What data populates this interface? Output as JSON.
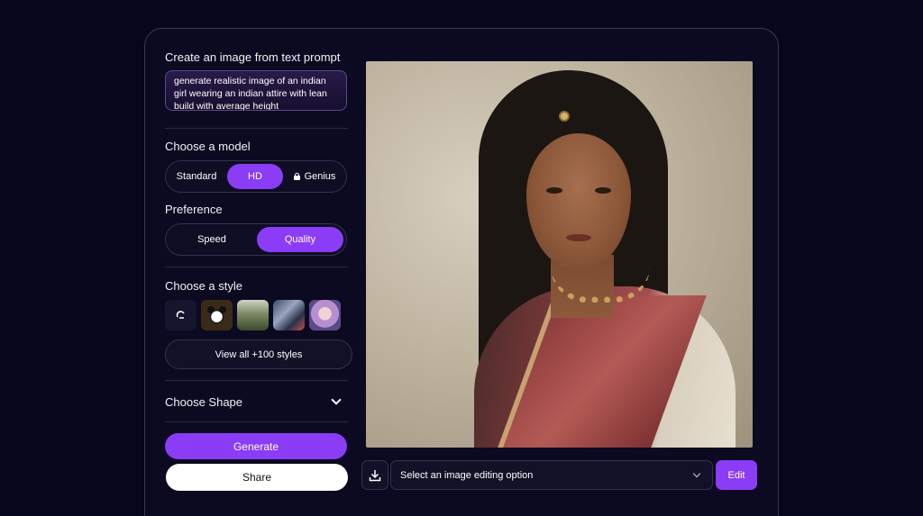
{
  "prompt_section": {
    "title": "Create an image from text prompt",
    "prompt_text": "generate realistic image of an indian girl wearing an indian attire with lean build with average height"
  },
  "model_section": {
    "title": "Choose a model",
    "options": [
      "Standard",
      "HD",
      "Genius"
    ],
    "selected": "HD",
    "locked": [
      "Genius"
    ]
  },
  "preference_section": {
    "title": "Preference",
    "options": [
      "Speed",
      "Quality"
    ],
    "selected": "Quality"
  },
  "style_section": {
    "title": "Choose a style",
    "thumbnails": [
      "no-style",
      "panda",
      "forest",
      "robot",
      "anime-girl"
    ],
    "view_all_label": "View all +100 styles"
  },
  "shape_section": {
    "title": "Choose Shape"
  },
  "actions": {
    "generate_label": "Generate",
    "share_label": "Share"
  },
  "editor_bar": {
    "select_placeholder": "Select an image editing option",
    "edit_label": "Edit"
  },
  "colors": {
    "background": "#07061a",
    "accent": "#8b3cf6",
    "card_border": "#3a3854"
  }
}
